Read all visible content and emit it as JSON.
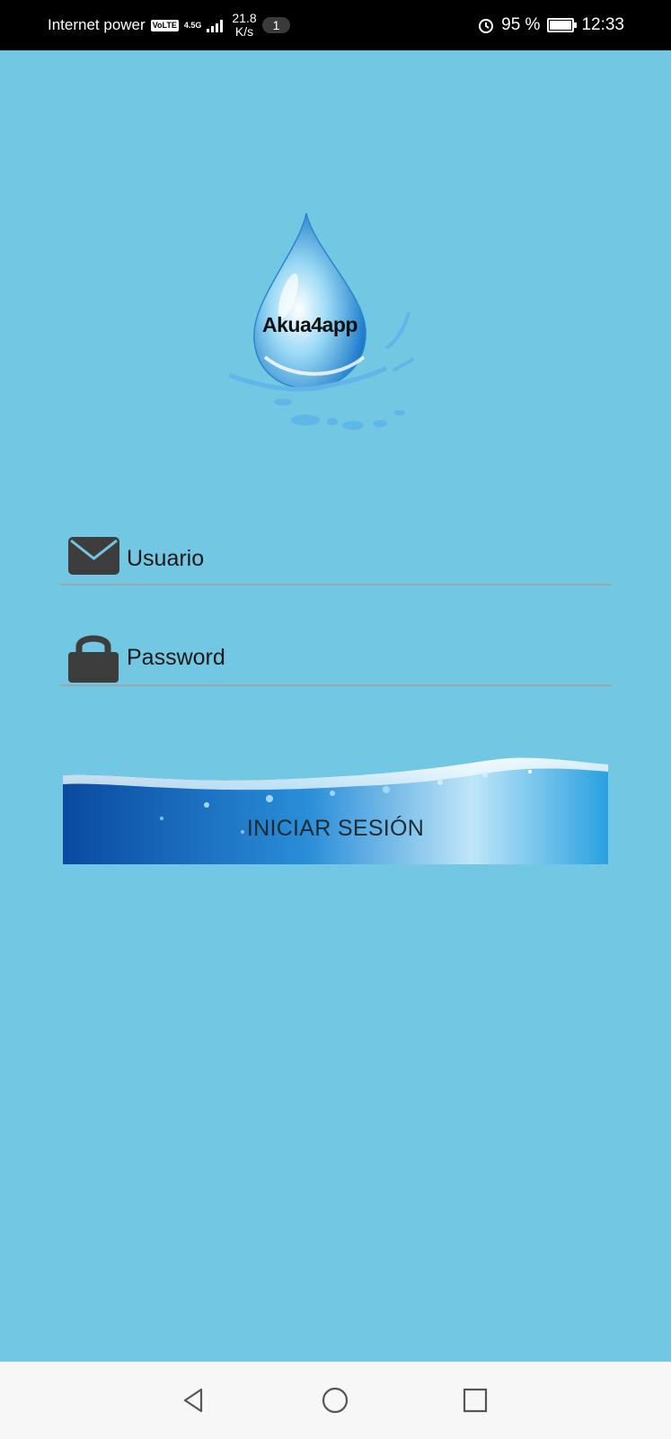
{
  "status_bar": {
    "carrier": "Internet power",
    "volte": "VoLTE",
    "network": "4.5G",
    "speed_value": "21.8",
    "speed_unit": "K/s",
    "notification_count": "1",
    "battery": "95 %",
    "time": "12:33"
  },
  "logo": {
    "text": "Akua4app"
  },
  "login": {
    "username_placeholder": "Usuario",
    "password_placeholder": "Password",
    "submit_label": "INICIAR SESIÓN"
  },
  "colors": {
    "background": "#72c7e2",
    "status_bar": "#000000",
    "icon": "#3d3d3d"
  },
  "icons": {
    "username": "envelope-icon",
    "password": "lock-icon",
    "nav_back": "back-triangle-icon",
    "nav_home": "home-circle-icon",
    "nav_recents": "recents-square-icon"
  }
}
